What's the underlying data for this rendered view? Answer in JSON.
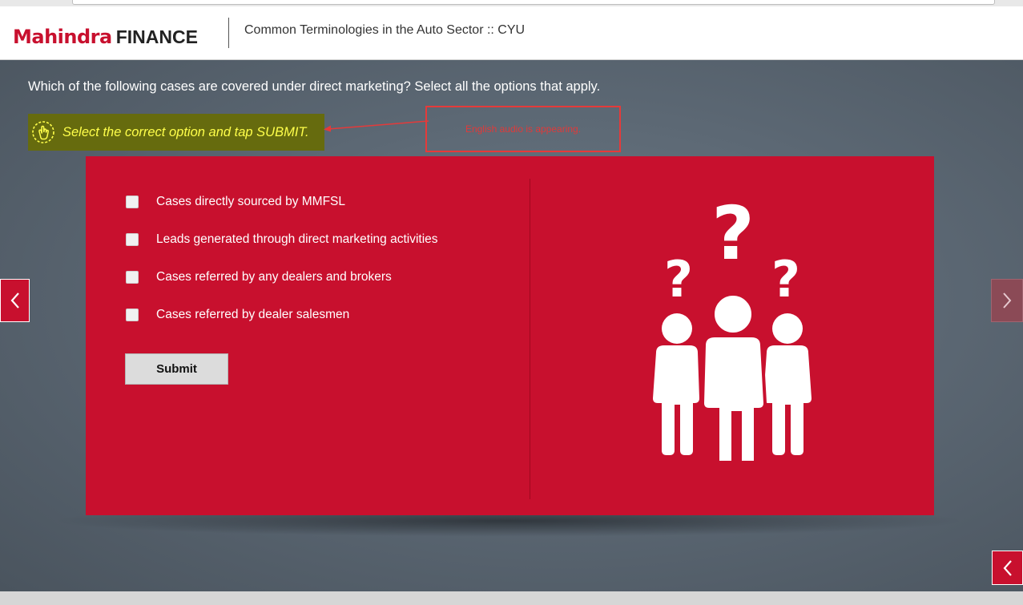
{
  "header": {
    "logo_brand": "Mahindra",
    "logo_suffix": "FINANCE",
    "course_title": "Common Terminologies in the Auto Sector :: CYU"
  },
  "question": {
    "text": "Which of the following cases are covered under direct marketing? Select all the options that apply.",
    "instruction": "Select the correct option and tap SUBMIT.",
    "instruction_icon": "tap-hand-icon"
  },
  "annotation": {
    "text": "English audio is appearing."
  },
  "options": [
    {
      "label": "Cases directly sourced by MMFSL",
      "checked": false
    },
    {
      "label": "Leads generated through direct marketing activities",
      "checked": false
    },
    {
      "label": "Cases referred by any dealers and brokers",
      "checked": false
    },
    {
      "label": "Cases referred by dealer salesmen",
      "checked": false
    }
  ],
  "submit_label": "Submit",
  "navigation": {
    "prev_icon": "chevron-left-icon",
    "next_icon": "chevron-right-icon",
    "back_icon": "chevron-left-icon"
  },
  "illustration": {
    "icon": "people-question-icon",
    "glyph": "?"
  },
  "colors": {
    "brand_red": "#c8102e",
    "instruction_bg": "#666b0e",
    "instruction_text": "#ffff4a",
    "annotation_red": "#e53a3a",
    "stage_bg": "#5c6874"
  }
}
